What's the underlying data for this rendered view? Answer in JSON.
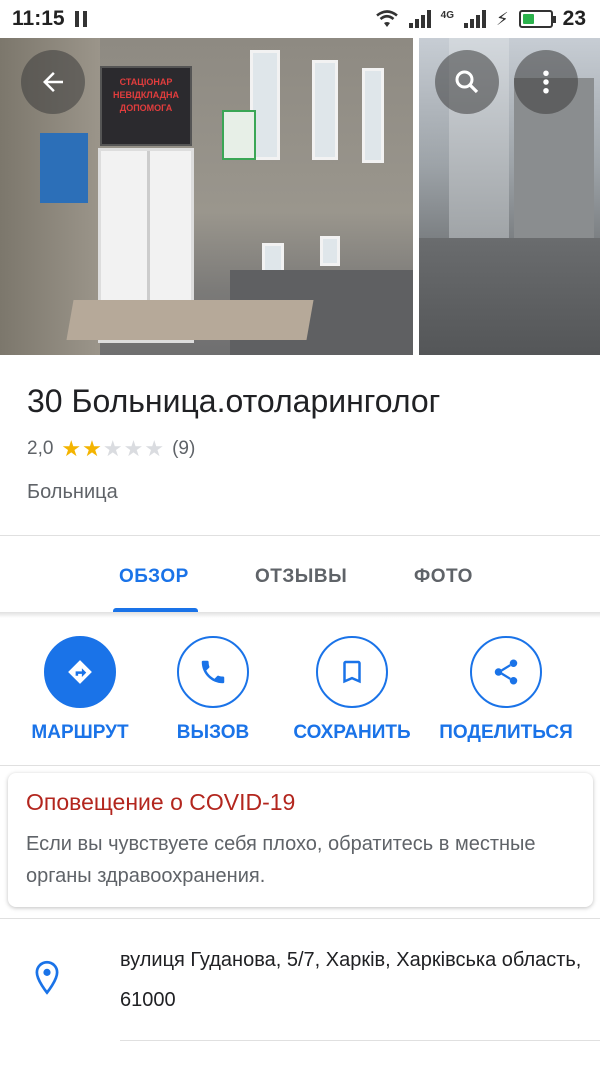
{
  "status_bar": {
    "time": "11:15",
    "network": "4G",
    "battery_level": "23"
  },
  "place": {
    "title": "30 Больница.отоларинголог",
    "rating": "2,0",
    "stars_filled": 2,
    "stars_total": 5,
    "review_count": "(9)",
    "category": "Больница",
    "photo_sign_text": "СТАЦІОНАР НЕВІДКЛАДНА ДОПОМОГА"
  },
  "tabs": [
    {
      "label": "ОБЗОР",
      "active": true
    },
    {
      "label": "ОТЗЫВЫ",
      "active": false
    },
    {
      "label": "ФОТО",
      "active": false
    }
  ],
  "actions": [
    {
      "label": "МАРШРУТ",
      "icon": "directions-icon"
    },
    {
      "label": "ВЫЗОВ",
      "icon": "phone-icon"
    },
    {
      "label": "СОХРАНИТЬ",
      "icon": "bookmark-icon"
    },
    {
      "label": "ПОДЕЛИТЬСЯ",
      "icon": "share-icon"
    }
  ],
  "covid": {
    "title": "Оповещение о COVID-19",
    "text": "Если вы чувствуете себя плохо, обратитесь в местные органы здравоохранения."
  },
  "address": {
    "text": "вулиця Гуданова, 5/7, Харків, Харківська область, 61000"
  },
  "colors": {
    "accent": "#1a73e8",
    "star": "#f4b400",
    "alert": "#b3261e"
  }
}
